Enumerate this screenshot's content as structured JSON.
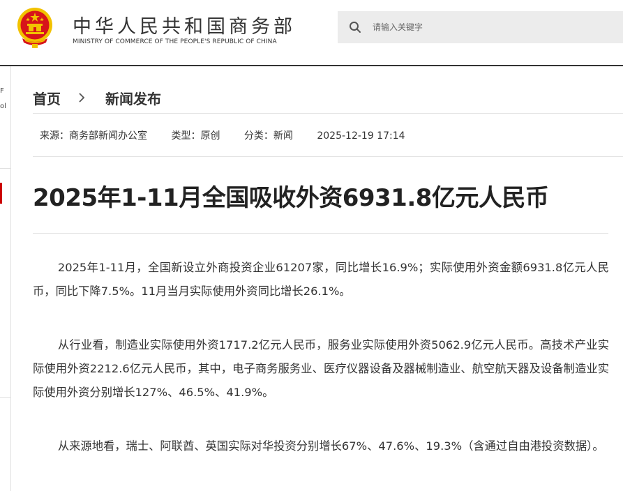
{
  "header": {
    "site_name_cn": "中华人民共和国商务部",
    "site_name_en": "MINISTRY OF COMMERCE OF THE PEOPLE'S REPUBLIC OF CHINA",
    "search_placeholder": "请输入关键字"
  },
  "sidebar": {
    "text1": "F",
    "text2": "ol"
  },
  "breadcrumb": {
    "home": "首页",
    "current": "新闻发布"
  },
  "meta": {
    "source": "来源：商务部新闻办公室",
    "type": "类型：原创",
    "category": "分类：新闻",
    "datetime": "2025-12-19 17:14"
  },
  "article": {
    "title": "2025年1-11月全国吸收外资6931.8亿元人民币",
    "paragraphs": [
      "2025年1-11月，全国新设立外商投资企业61207家，同比增长16.9%；实际使用外资金额6931.8亿元人民币，同比下降7.5%。11月当月实际使用外资同比增长26.1%。",
      "从行业看，制造业实际使用外资1717.2亿元人民币，服务业实际使用外资5062.9亿元人民币。高技术产业实际使用外资2212.6亿元人民币，其中，电子商务服务业、医疗仪器设备及器械制造业、航空航天器及设备制造业实际使用外资分别增长127%、46.5%、41.9%。",
      "从来源地看，瑞士、阿联酋、英国实际对华投资分别增长67%、47.6%、19.3%（含通过自由港投资数据）。"
    ]
  },
  "colors": {
    "emblem_red": "#d7141a",
    "emblem_gold": "#f2c200",
    "accent_red": "#cc0000"
  }
}
